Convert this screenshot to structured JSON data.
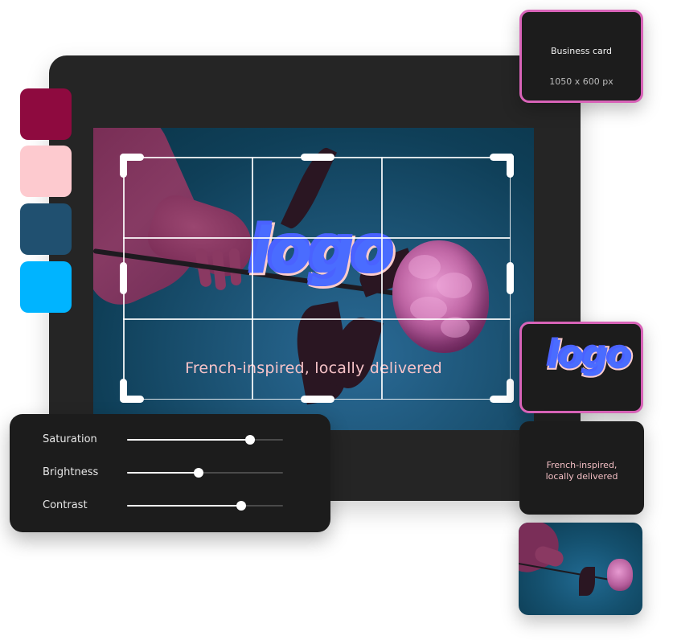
{
  "palette": {
    "swatches": [
      {
        "name": "crimson",
        "color": "#8e0a3f"
      },
      {
        "name": "blush",
        "color": "#fdcacf"
      },
      {
        "name": "slate-blue",
        "color": "#205070"
      },
      {
        "name": "sky-blue",
        "color": "#00b4ff"
      }
    ]
  },
  "canvas": {
    "logo_text": "logo",
    "tagline": "French-inspired, locally delivered"
  },
  "adjustments": {
    "sliders": [
      {
        "label": "Saturation",
        "value": 0.79
      },
      {
        "label": "Brightness",
        "value": 0.46
      },
      {
        "label": "Contrast",
        "value": 0.73
      }
    ]
  },
  "cards": {
    "business_card": {
      "title": "Business card",
      "size": "1050 x 600 px"
    },
    "logo_preview": {
      "text": "logo"
    },
    "tagline_preview": {
      "line1": "French-inspired,",
      "line2": "locally delivered"
    }
  },
  "colors": {
    "accent_border": "#d863b8",
    "logo_fill": "#4a6cff",
    "logo_outline": "#ffcccb"
  }
}
